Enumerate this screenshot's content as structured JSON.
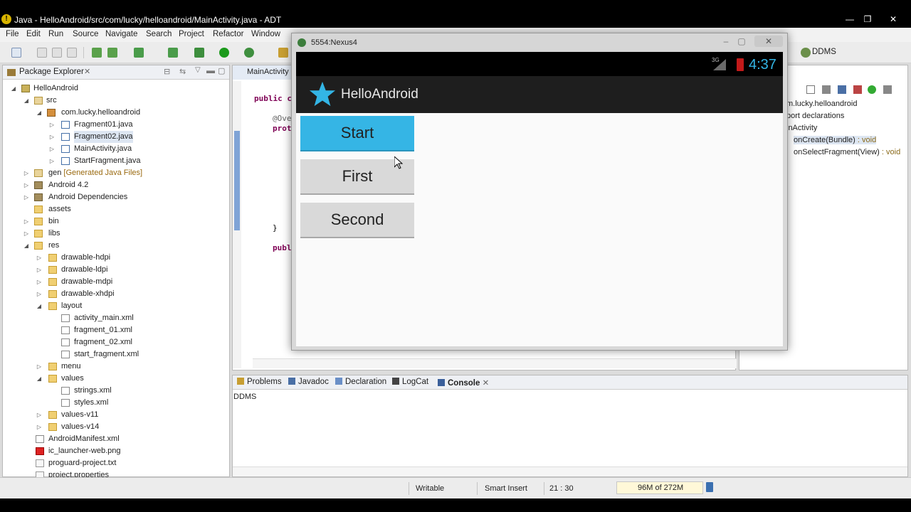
{
  "window": {
    "title": "Java - HelloAndroid/src/com/lucky/helloandroid/MainActivity.java - ADT",
    "controls": [
      "—",
      "❐",
      "✕"
    ]
  },
  "menu": [
    "File",
    "Edit",
    "Run",
    "Source",
    "Navigate",
    "Search",
    "Project",
    "Refactor",
    "Window"
  ],
  "package_explorer": {
    "title": "Package Explorer",
    "items": [
      {
        "label": "HelloAndroid"
      },
      {
        "label": "src"
      },
      {
        "label": "com.lucky.helloandroid"
      },
      {
        "label": "Fragment01.java"
      },
      {
        "label": "Fragment02.java"
      },
      {
        "label": "MainActivity.java"
      },
      {
        "label": "StartFragment.java"
      },
      {
        "label": "gen",
        "decoration": "[Generated Java Files]"
      },
      {
        "label": "Android 4.2"
      },
      {
        "label": "Android Dependencies"
      },
      {
        "label": "assets"
      },
      {
        "label": "bin"
      },
      {
        "label": "libs"
      },
      {
        "label": "res"
      },
      {
        "label": "drawable-hdpi"
      },
      {
        "label": "drawable-ldpi"
      },
      {
        "label": "drawable-mdpi"
      },
      {
        "label": "drawable-xhdpi"
      },
      {
        "label": "layout"
      },
      {
        "label": "activity_main.xml"
      },
      {
        "label": "fragment_01.xml"
      },
      {
        "label": "fragment_02.xml"
      },
      {
        "label": "start_fragment.xml"
      },
      {
        "label": "menu"
      },
      {
        "label": "values"
      },
      {
        "label": "strings.xml"
      },
      {
        "label": "styles.xml"
      },
      {
        "label": "values-v11"
      },
      {
        "label": "values-v14"
      },
      {
        "label": "AndroidManifest.xml"
      },
      {
        "label": "ic_launcher-web.png"
      },
      {
        "label": "proguard-project.txt"
      },
      {
        "label": "project.properties"
      }
    ]
  },
  "editor": {
    "tab": "MainActivity",
    "lines": [
      "public c",
      "@Ove",
      "prot",
      "}",
      "publ"
    ]
  },
  "outline": {
    "perspective": "DDMS",
    "items": [
      {
        "label": "m.lucky.helloandroid",
        "type": ""
      },
      {
        "label": "port declarations",
        "type": ""
      },
      {
        "label": "inActivity",
        "type": ""
      },
      {
        "label": "onCreate(Bundle)",
        "type": " : void"
      },
      {
        "label": "onSelectFragment(View)",
        "type": " : void"
      }
    ]
  },
  "bottom_panel": {
    "tabs": [
      "Problems",
      "Javadoc",
      "Declaration",
      "LogCat",
      "Console"
    ],
    "console_label": "DDMS"
  },
  "status_bar": {
    "writable": "Writable",
    "insert_mode": "Smart Insert",
    "position": "21 : 30",
    "heap": "96M of 272M"
  },
  "emulator": {
    "title": "5554:Nexus4",
    "clock": "4:37",
    "network": "3G",
    "app_title": "HelloAndroid",
    "buttons": [
      "Start",
      "First",
      "Second"
    ],
    "accent": "#33b5e5"
  }
}
